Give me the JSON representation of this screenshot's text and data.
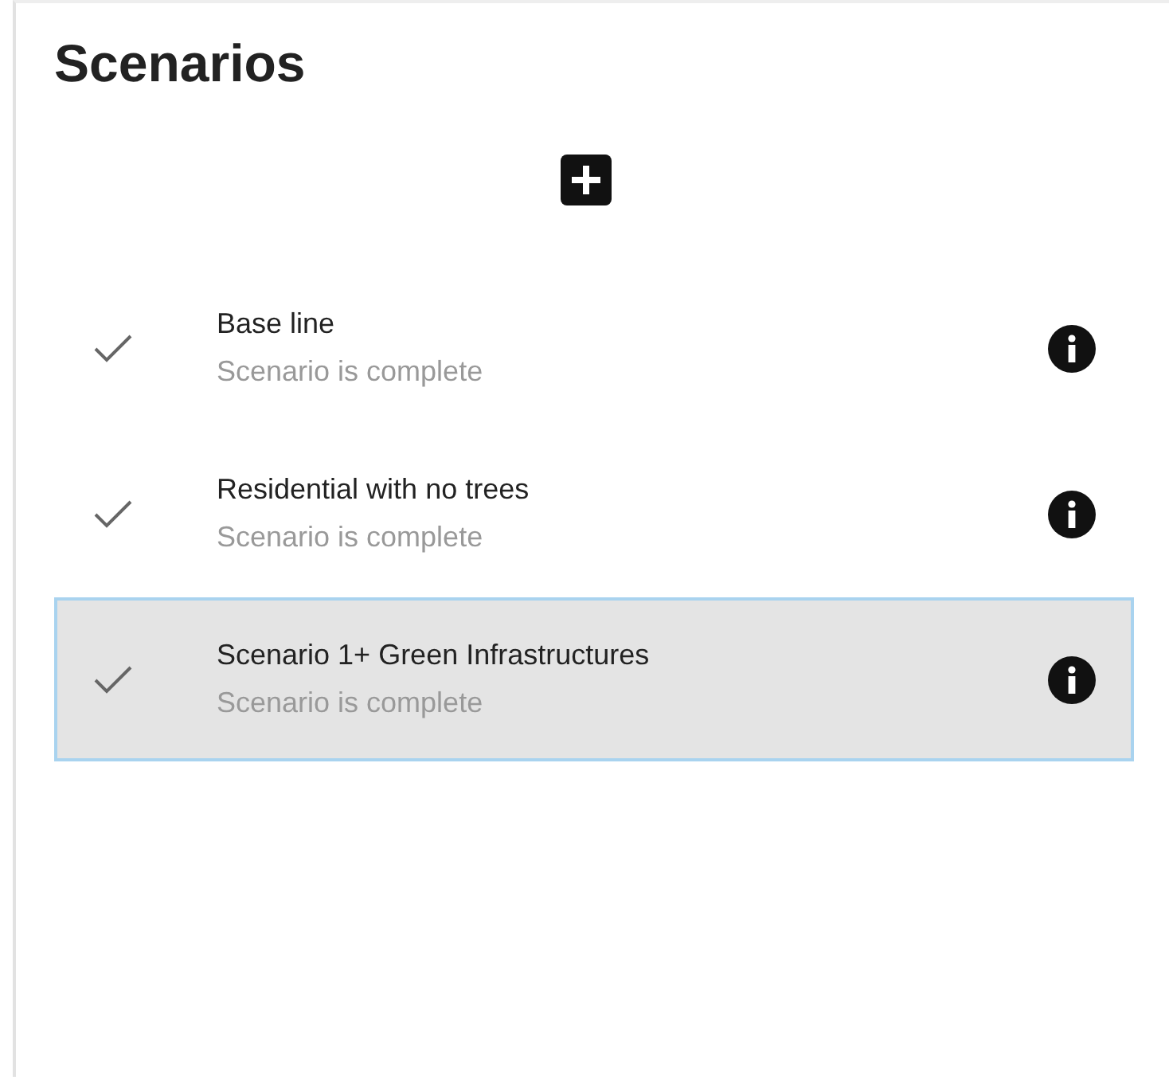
{
  "panel": {
    "title": "Scenarios"
  },
  "scenarios": [
    {
      "name": "Base line",
      "status": "Scenario is complete",
      "complete": true,
      "selected": false
    },
    {
      "name": "Residential with no trees",
      "status": "Scenario is complete",
      "complete": true,
      "selected": false
    },
    {
      "name": "Scenario 1+ Green Infrastructures",
      "status": "Scenario is complete",
      "complete": true,
      "selected": true
    }
  ]
}
